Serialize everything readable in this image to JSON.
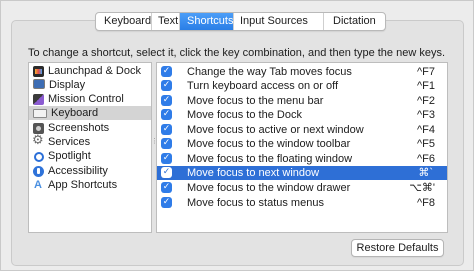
{
  "tabs": [
    {
      "label": "Keyboard",
      "active": false
    },
    {
      "label": "Text",
      "active": false
    },
    {
      "label": "Shortcuts",
      "active": true
    },
    {
      "label": "Input Sources",
      "active": false
    },
    {
      "label": "Dictation",
      "active": false
    }
  ],
  "instructions": "To change a shortcut, select it, click the key combination, and then type the new keys.",
  "categories": [
    {
      "label": "Launchpad & Dock",
      "icon": "launchpad-icon",
      "selected": false
    },
    {
      "label": "Display",
      "icon": "display-icon",
      "selected": false
    },
    {
      "label": "Mission Control",
      "icon": "mission-control-icon",
      "selected": false
    },
    {
      "label": "Keyboard",
      "icon": "keyboard-icon",
      "selected": true
    },
    {
      "label": "Screenshots",
      "icon": "screenshots-icon",
      "selected": false
    },
    {
      "label": "Services",
      "icon": "services-gear-icon",
      "selected": false
    },
    {
      "label": "Spotlight",
      "icon": "spotlight-icon",
      "selected": false
    },
    {
      "label": "Accessibility",
      "icon": "accessibility-icon",
      "selected": false
    },
    {
      "label": "App Shortcuts",
      "icon": "app-shortcuts-icon",
      "selected": false
    }
  ],
  "shortcuts": [
    {
      "label": "Change the way Tab moves focus",
      "keys": "^F7",
      "checked": true,
      "selected": false
    },
    {
      "label": "Turn keyboard access on or off",
      "keys": "^F1",
      "checked": true,
      "selected": false
    },
    {
      "label": "Move focus to the menu bar",
      "keys": "^F2",
      "checked": true,
      "selected": false
    },
    {
      "label": "Move focus to the Dock",
      "keys": "^F3",
      "checked": true,
      "selected": false
    },
    {
      "label": "Move focus to active or next window",
      "keys": "^F4",
      "checked": true,
      "selected": false
    },
    {
      "label": "Move focus to the window toolbar",
      "keys": "^F5",
      "checked": true,
      "selected": false
    },
    {
      "label": "Move focus to the floating window",
      "keys": "^F6",
      "checked": true,
      "selected": false
    },
    {
      "label": "Move focus to next window",
      "keys": "⌘`",
      "checked": true,
      "selected": true
    },
    {
      "label": "Move focus to the window drawer",
      "keys": "⌥⌘'",
      "checked": true,
      "selected": false
    },
    {
      "label": "Move focus to status menus",
      "keys": "^F8",
      "checked": true,
      "selected": false
    }
  ],
  "check_glyph": "✓",
  "splitter_glyph": "⋮",
  "restore_button": "Restore Defaults",
  "colors": {
    "accent": "#2e6fd6",
    "selected_category": "#d4d4d4",
    "background": "#ececec"
  }
}
